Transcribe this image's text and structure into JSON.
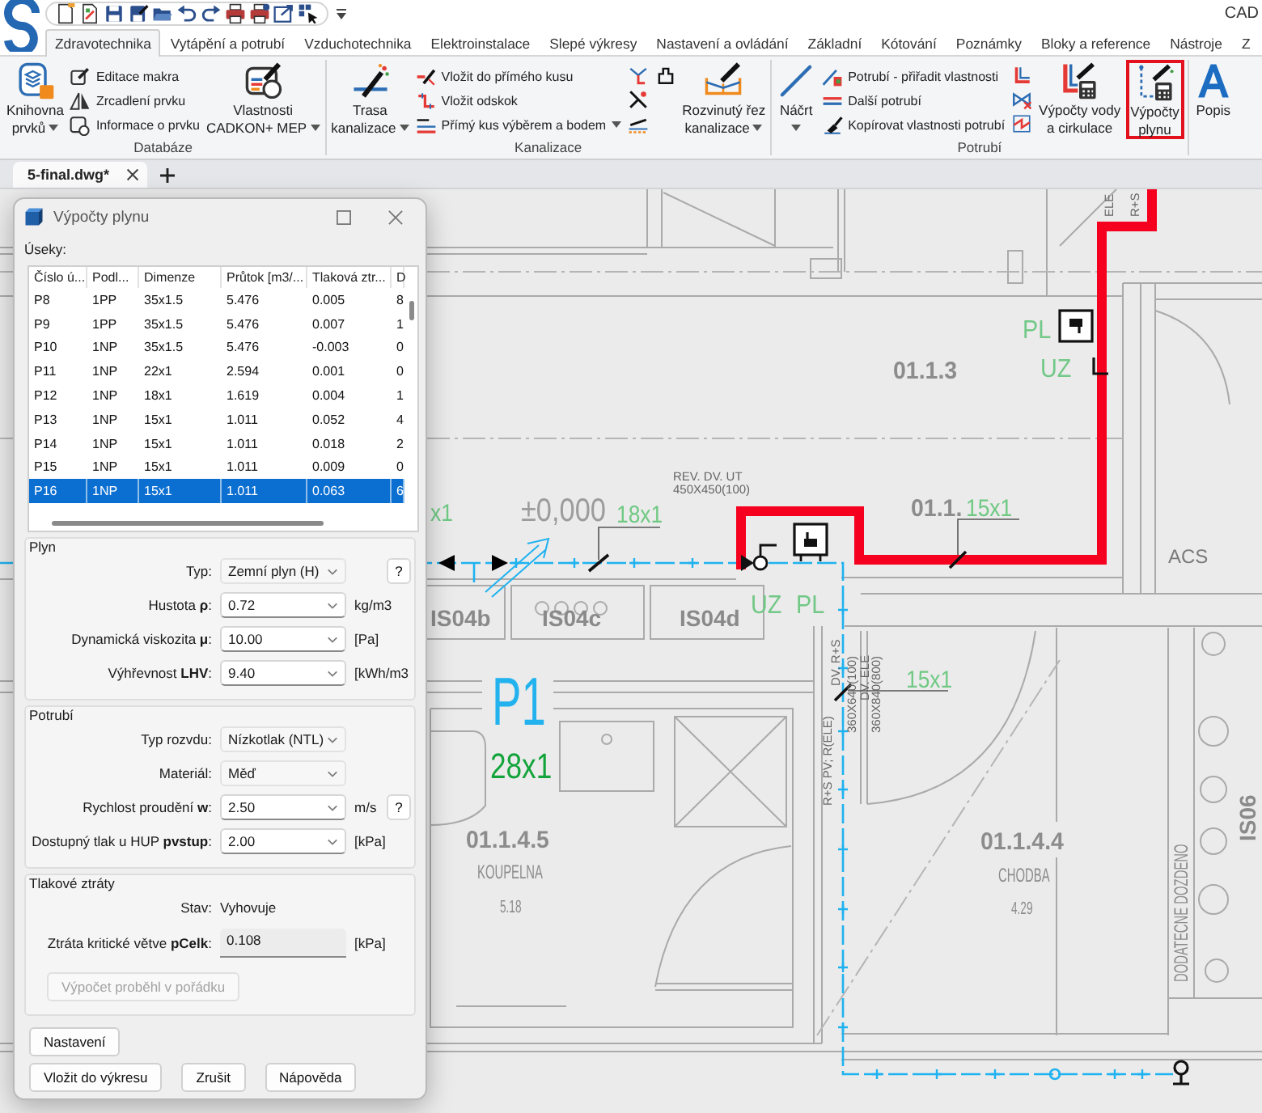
{
  "app": {
    "title": "CAD"
  },
  "ribbon": {
    "tabs": [
      {
        "label": "Zdravotechnika",
        "selected": true
      },
      {
        "label": "Vytápění a potrubí",
        "selected": false
      },
      {
        "label": "Vzduchotechnika",
        "selected": false
      },
      {
        "label": "Elektroinstalace",
        "selected": false
      },
      {
        "label": "Slepé výkresy",
        "selected": false
      },
      {
        "label": "Nastavení a ovládání",
        "selected": false
      },
      {
        "label": "Základní",
        "selected": false
      },
      {
        "label": "Kótování",
        "selected": false
      },
      {
        "label": "Poznámky",
        "selected": false
      },
      {
        "label": "Bloky a reference",
        "selected": false
      },
      {
        "label": "Nástroje",
        "selected": false
      },
      {
        "label": "Z",
        "selected": false
      }
    ],
    "groups": [
      {
        "title": "Databáze",
        "items": [
          {
            "kind": "large",
            "lines": [
              "Knihovna",
              "prvků"
            ],
            "dropdown": true,
            "highlighted": false
          },
          {
            "kind": "stack",
            "buttons": [
              {
                "label": "Editace makra",
                "dropdown": false
              },
              {
                "label": "Zrcadlení prvku",
                "dropdown": false
              },
              {
                "label": "Informace o prvku",
                "dropdown": false
              }
            ]
          },
          {
            "kind": "large",
            "lines": [
              "Vlastnosti",
              "CADKON+ MEP"
            ],
            "dropdown": true,
            "highlighted": false
          }
        ]
      },
      {
        "title": "Kanalizace",
        "items": [
          {
            "kind": "large",
            "lines": [
              "Trasa",
              "kanalizace"
            ],
            "dropdown": true,
            "highlighted": false
          },
          {
            "kind": "stack",
            "buttons": [
              {
                "label": "Vložit do přímého kusu",
                "dropdown": false
              },
              {
                "label": "Vložit odskok",
                "dropdown": false
              },
              {
                "label": "Přímý kus výběrem a bodem",
                "dropdown": true
              }
            ]
          },
          {
            "kind": "tools"
          },
          {
            "kind": "large",
            "lines": [
              "Rozvinutý řez",
              "kanalizace"
            ],
            "dropdown": true,
            "highlighted": false
          }
        ]
      },
      {
        "title": "Potrubí",
        "items": [
          {
            "kind": "large",
            "lines": [
              "Náčrt"
            ],
            "dropdown": true,
            "highlighted": false
          },
          {
            "kind": "stack",
            "buttons": [
              {
                "label": "Potrubí - přiřadit vlastnosti",
                "dropdown": false
              },
              {
                "label": "Další potrubí",
                "dropdown": false
              },
              {
                "label": "Kopírovat vlastnosti potrubí",
                "dropdown": false
              }
            ]
          },
          {
            "kind": "tools"
          },
          {
            "kind": "large",
            "lines": [
              "Výpočty vody",
              "a cirkulace"
            ],
            "dropdown": false,
            "highlighted": false
          },
          {
            "kind": "large",
            "lines": [
              "Výpočty",
              "plynu"
            ],
            "dropdown": false,
            "highlighted": true
          }
        ]
      },
      {
        "items": [
          {
            "kind": "large",
            "lines": [
              "Popis"
            ],
            "dropdown": false,
            "highlighted": false
          }
        ]
      }
    ]
  },
  "document_tabs": [
    {
      "label": "5-final.dwg*",
      "selected": true
    }
  ],
  "drawing": {
    "labels": [
      {
        "kind": "note",
        "text": "ELE"
      },
      {
        "kind": "note",
        "text": "R+S"
      },
      {
        "kind": "mark",
        "text": "PL"
      },
      {
        "kind": "room",
        "text": "01.1.3"
      },
      {
        "kind": "mark",
        "text": "UZ"
      },
      {
        "kind": "note",
        "text": "REV. DV. UT"
      },
      {
        "kind": "note",
        "text": "450X450(100)"
      },
      {
        "kind": "dimension",
        "text": "x1"
      },
      {
        "kind": "level",
        "text": "±0,000"
      },
      {
        "kind": "dimension",
        "text": "18x1"
      },
      {
        "kind": "room",
        "text": "01.1."
      },
      {
        "kind": "dimension",
        "text": "15x1"
      },
      {
        "kind": "label",
        "text": "ACS"
      },
      {
        "kind": "mark",
        "text": "UZ"
      },
      {
        "kind": "mark",
        "text": "PL"
      },
      {
        "kind": "tag",
        "text": "IS04b"
      },
      {
        "kind": "tag",
        "text": "IS04c"
      },
      {
        "kind": "tag",
        "text": "IS04d"
      },
      {
        "kind": "section",
        "text": "P1"
      },
      {
        "kind": "dimension",
        "text": "15x1"
      },
      {
        "kind": "note",
        "text": "DV. R+S"
      },
      {
        "kind": "note",
        "text": "360X640(100)"
      },
      {
        "kind": "note",
        "text": "DV. ELE"
      },
      {
        "kind": "note",
        "text": "360X840(800)"
      },
      {
        "kind": "main_dimension",
        "text": "28x1"
      },
      {
        "kind": "note",
        "text": "R+S PV; R(ELE)"
      },
      {
        "kind": "tag",
        "text": "IS06"
      },
      {
        "kind": "room",
        "text": "01.1.4.5"
      },
      {
        "kind": "room",
        "text": "01.1.4.4"
      },
      {
        "kind": "room_name",
        "text": "KOUPELNA"
      },
      {
        "kind": "room_name",
        "text": "CHODBA"
      },
      {
        "kind": "area",
        "text": "5.18"
      },
      {
        "kind": "area",
        "text": "4.29"
      },
      {
        "kind": "annotation",
        "text": "DODATECNE DOZDENO"
      }
    ]
  },
  "dialog": {
    "title": "Výpočty plynu",
    "table_label": "Úseky:",
    "table": {
      "columns": [
        "Číslo ú...",
        "Podl...",
        "Dimenze",
        "Průtok [m3/...",
        "Tlaková ztr...",
        "D"
      ],
      "rows": [
        {
          "cells": [
            "P8",
            "1PP",
            "35x1.5",
            "5.476",
            "0.005",
            "8"
          ],
          "selected": false
        },
        {
          "cells": [
            "P9",
            "1PP",
            "35x1.5",
            "5.476",
            "0.007",
            "1"
          ],
          "selected": false
        },
        {
          "cells": [
            "P10",
            "1NP",
            "35x1.5",
            "5.476",
            "-0.003",
            "0"
          ],
          "selected": false
        },
        {
          "cells": [
            "P11",
            "1NP",
            "22x1",
            "2.594",
            "0.001",
            "0"
          ],
          "selected": false
        },
        {
          "cells": [
            "P12",
            "1NP",
            "18x1",
            "1.619",
            "0.004",
            "1"
          ],
          "selected": false
        },
        {
          "cells": [
            "P13",
            "1NP",
            "15x1",
            "1.011",
            "0.052",
            "4"
          ],
          "selected": false
        },
        {
          "cells": [
            "P14",
            "1NP",
            "15x1",
            "1.011",
            "0.018",
            "2"
          ],
          "selected": false
        },
        {
          "cells": [
            "P15",
            "1NP",
            "15x1",
            "1.011",
            "0.009",
            "0"
          ],
          "selected": false
        },
        {
          "cells": [
            "P16",
            "1NP",
            "15x1",
            "1.011",
            "0.063",
            "6"
          ],
          "selected": true
        }
      ]
    },
    "groups": [
      {
        "title": "Plyn",
        "fields": [
          {
            "kind": "select",
            "label": "Typ:",
            "value": "Zemní plyn (H)",
            "help": "?"
          },
          {
            "kind": "combo",
            "label": "Hustota **ρ**:",
            "value": "0.72",
            "unit": "kg/m3"
          },
          {
            "kind": "combo",
            "label": "Dynamická viskozita **μ**:",
            "value": "10.00",
            "unit": "[Pa]"
          },
          {
            "kind": "combo",
            "label": "Výhřevnost **LHV**:",
            "value": "9.40",
            "unit": "[kWh/m3"
          }
        ]
      },
      {
        "title": "Potrubí",
        "fields": [
          {
            "kind": "select",
            "label": "Typ rozvdu:",
            "value": "Nízkotlak (NTL)"
          },
          {
            "kind": "select",
            "label": "Materiál:",
            "value": "Měď"
          },
          {
            "kind": "combo",
            "label": "Rychlost proudění **w**:",
            "value": "2.50",
            "unit": "m/s",
            "help": "?"
          },
          {
            "kind": "combo",
            "label": "Dostupný tlak u HUP **pvstup**:",
            "value": "2.00",
            "unit": "[kPa]"
          }
        ]
      },
      {
        "title": "Tlakové ztráty",
        "fields": [
          {
            "kind": "status",
            "label": "Stav:",
            "value": "Vyhovuje"
          },
          {
            "kind": "readonly",
            "label": "Ztráta kritické větve **pCelk**:",
            "value": "0.108",
            "unit": "[kPa]"
          },
          {
            "kind": "button",
            "label": "Výpočet proběhl v pořádku",
            "disabled": true
          }
        ]
      }
    ],
    "settings_button": "Nastavení",
    "buttons": [
      "Vložit do výkresu",
      "Zrušit",
      "Nápověda"
    ]
  }
}
